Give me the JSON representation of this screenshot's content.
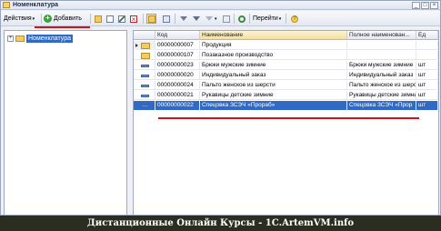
{
  "window": {
    "title": "Номенклатура"
  },
  "toolbar": {
    "actions_label": "Действия",
    "add_label": "Добавить",
    "goto_label": "Перейти",
    "help_label": "?"
  },
  "tree": {
    "root_label": "Номенклатура"
  },
  "table": {
    "columns": [
      "Код",
      "Наименование",
      "Полное наименован...",
      "Ед"
    ],
    "rows": [
      {
        "type": "folder",
        "code": "00000000007",
        "name": "Продукция",
        "full_name": "",
        "unit": ""
      },
      {
        "type": "folder",
        "code": "00000000107",
        "name": "Позаказное производство",
        "full_name": "",
        "unit": ""
      },
      {
        "type": "item",
        "code": "00000000023",
        "name": "Брюки мужские зимние",
        "full_name": "Брюки мужские зимние",
        "unit": "шт"
      },
      {
        "type": "item",
        "code": "00000000020",
        "name": "Индивидуальный заказ",
        "full_name": "Индивидуальный заказ",
        "unit": "шт"
      },
      {
        "type": "item",
        "code": "00000000024",
        "name": "Пальто женское из шерсти",
        "full_name": "Пальто женское из шерсти",
        "unit": "шт"
      },
      {
        "type": "item",
        "code": "00000000021",
        "name": "Рукавицы детские зимние",
        "full_name": "Рукавицы детские зимние",
        "unit": "шт"
      },
      {
        "type": "item",
        "code": "00000000022",
        "name": "Спецовка ЗСЭЧ «Прораб»",
        "full_name": "Спецовка ЗСЭЧ «Прор",
        "unit": "шт"
      }
    ]
  },
  "footer": {
    "caption": "Дистанционные Онлайн Курсы - 1С.ArtemVM.info"
  },
  "colors": {
    "selection": "#316ac5",
    "highlight_line": "#d0121c",
    "footer_bg": "#2b2d20"
  }
}
